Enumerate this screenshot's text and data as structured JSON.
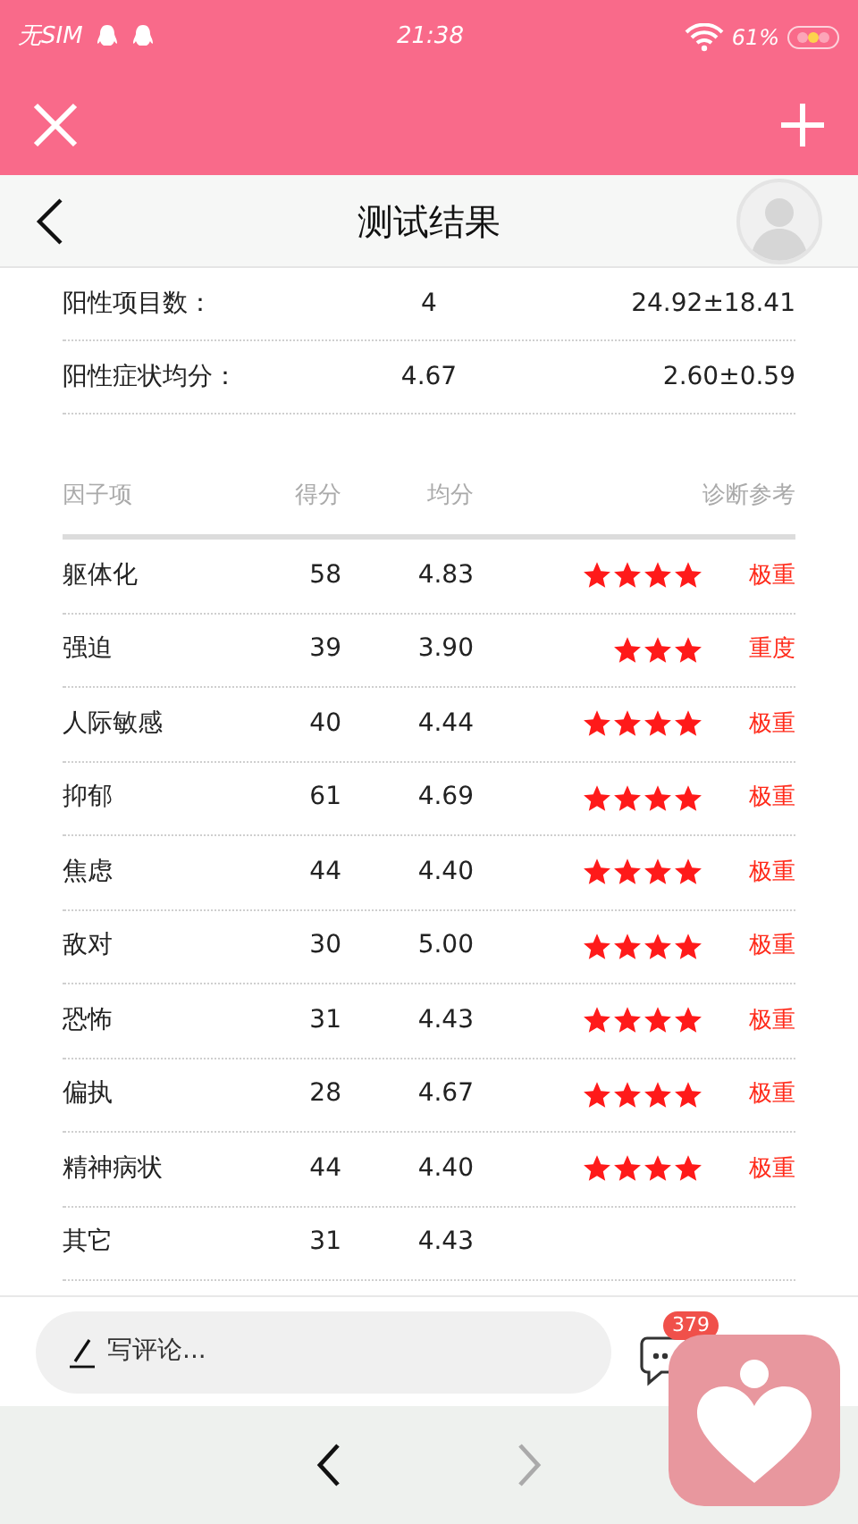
{
  "status_bar": {
    "carrier": "无SIM",
    "time": "21:38",
    "battery": "61%"
  },
  "title_bar": {
    "title": "测试结果"
  },
  "summary": [
    {
      "label": "阳性项目数：",
      "value": "4",
      "reference": "24.92±18.41"
    },
    {
      "label": "阳性症状均分：",
      "value": "4.67",
      "reference": "2.60±0.59"
    }
  ],
  "table": {
    "columns": [
      "因子项",
      "得分",
      "均分",
      "诊断参考"
    ],
    "rows": [
      {
        "factor": "躯体化",
        "score": "58",
        "mean": "4.83",
        "stars": 4,
        "severity": "极重"
      },
      {
        "factor": "强迫",
        "score": "39",
        "mean": "3.90",
        "stars": 3,
        "severity": "重度"
      },
      {
        "factor": "人际敏感",
        "score": "40",
        "mean": "4.44",
        "stars": 4,
        "severity": "极重"
      },
      {
        "factor": "抑郁",
        "score": "61",
        "mean": "4.69",
        "stars": 4,
        "severity": "极重"
      },
      {
        "factor": "焦虑",
        "score": "44",
        "mean": "4.40",
        "stars": 4,
        "severity": "极重"
      },
      {
        "factor": "敌对",
        "score": "30",
        "mean": "5.00",
        "stars": 4,
        "severity": "极重"
      },
      {
        "factor": "恐怖",
        "score": "31",
        "mean": "4.43",
        "stars": 4,
        "severity": "极重"
      },
      {
        "factor": "偏执",
        "score": "28",
        "mean": "4.67",
        "stars": 4,
        "severity": "极重"
      },
      {
        "factor": "精神病状",
        "score": "44",
        "mean": "4.40",
        "stars": 4,
        "severity": "极重"
      },
      {
        "factor": "其它",
        "score": "31",
        "mean": "4.43"
      }
    ]
  },
  "comment_bar": {
    "placeholder": "写评论...",
    "comment_count": "379"
  }
}
